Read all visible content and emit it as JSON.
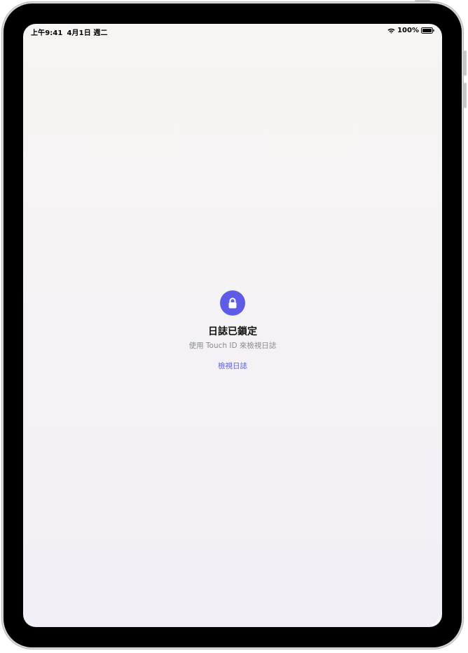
{
  "status_bar": {
    "time": "上午9:41",
    "date": "4月1日 週二",
    "battery": "100%",
    "wifi_icon": "wifi-icon",
    "battery_icon": "battery-full-icon"
  },
  "lock_screen": {
    "icon": "lock-icon",
    "title": "日誌已鎖定",
    "subtitle": "使用 Touch ID 來檢視日誌",
    "action_label": "檢視日誌"
  },
  "colors": {
    "accent": "#5e5ce6",
    "subtitle": "#8a8a8e",
    "background": "#f5f3f4"
  }
}
